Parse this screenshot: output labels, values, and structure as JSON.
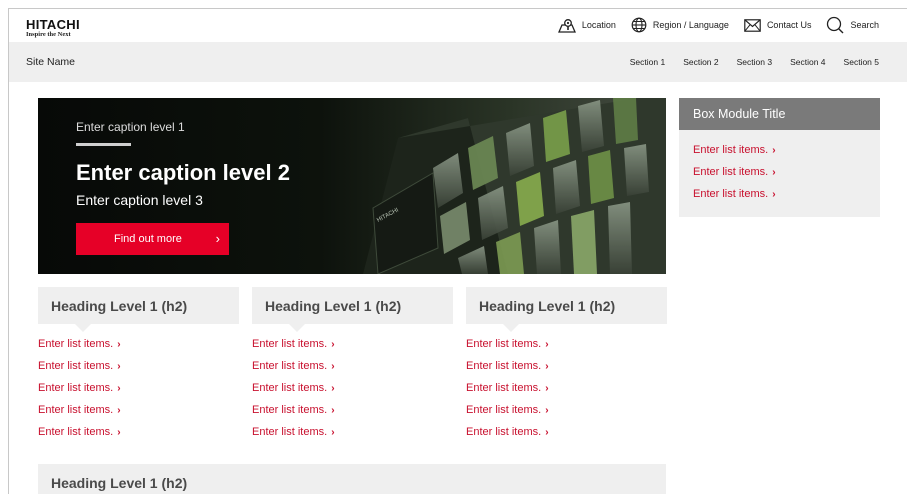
{
  "brand": {
    "name": "HITACHI",
    "tagline": "Inspire the Next"
  },
  "utility_nav": [
    {
      "label": "Location",
      "icon": "location-pin-icon"
    },
    {
      "label": "Region / Language",
      "icon": "globe-icon"
    },
    {
      "label": "Contact Us",
      "icon": "envelope-icon"
    },
    {
      "label": "Search",
      "icon": "search-icon"
    }
  ],
  "site": {
    "name": "Site Name",
    "sections": [
      "Section 1",
      "Section 2",
      "Section 3",
      "Section 4",
      "Section 5"
    ]
  },
  "hero": {
    "caption_level_1": "Enter caption level 1",
    "caption_level_2": "Enter caption level 2",
    "caption_level_3": "Enter caption level 3",
    "cta_label": "Find out more",
    "cta_icon": "chevron-right-icon"
  },
  "box_module": {
    "title": "Box Module Title",
    "items": [
      "Enter list items.",
      "Enter list items.",
      "Enter list items."
    ]
  },
  "columns": [
    {
      "heading": "Heading Level 1 (h2)",
      "items": [
        "Enter list items.",
        "Enter list items.",
        "Enter list items.",
        "Enter list items.",
        "Enter list items."
      ]
    },
    {
      "heading": "Heading Level 1 (h2)",
      "items": [
        "Enter list items.",
        "Enter list items.",
        "Enter list items.",
        "Enter list items.",
        "Enter list items."
      ]
    },
    {
      "heading": "Heading Level 1 (h2)",
      "items": [
        "Enter list items.",
        "Enter list items.",
        "Enter list items.",
        "Enter list items.",
        "Enter list items."
      ]
    }
  ],
  "bottom_heading": "Heading Level 1 (h2)",
  "colors": {
    "accent_red": "#e60027",
    "link_red": "#c8102e",
    "panel_gray": "#efefef",
    "box_title_gray": "#7a7a7a"
  }
}
